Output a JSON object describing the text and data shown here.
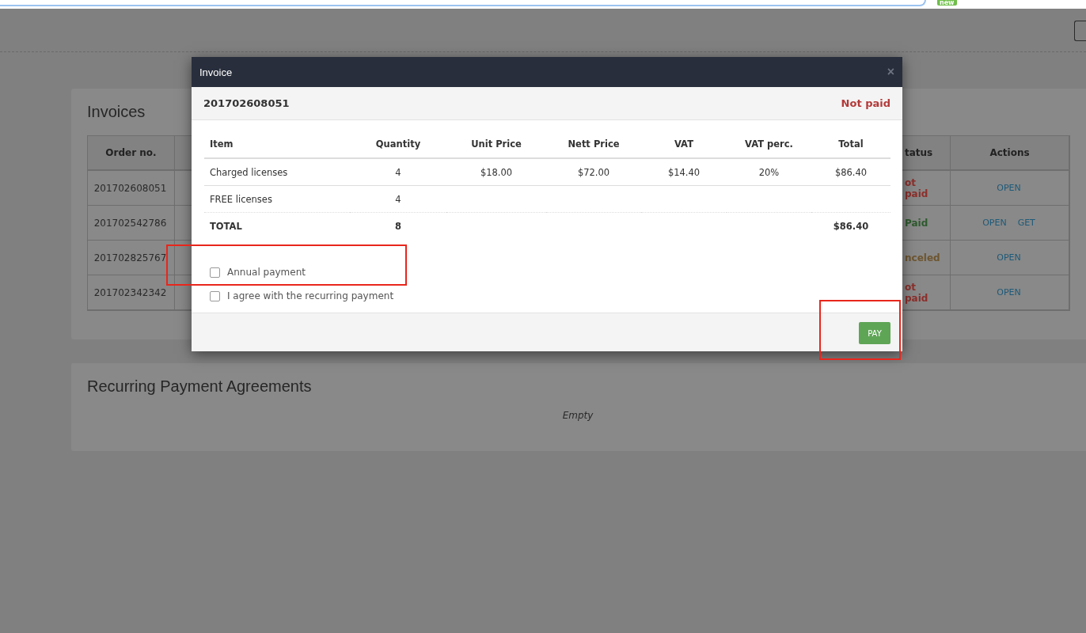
{
  "browser": {
    "badge": "new"
  },
  "invoices": {
    "title": "Invoices",
    "columns": {
      "order_no": "Order no.",
      "status": "tatus",
      "actions": "Actions"
    },
    "rows": [
      {
        "order_no": "201702608051",
        "status": {
          "text": "ot paid",
          "color": "#8c2f2b"
        },
        "actions": [
          "OPEN"
        ]
      },
      {
        "order_no": "201702542786",
        "status": {
          "text": "Paid",
          "color": "#2e5a2e"
        },
        "actions": [
          "OPEN",
          "GET"
        ]
      },
      {
        "order_no": "201702825767",
        "status": {
          "text": "nceled",
          "color": "#6e5530"
        },
        "actions": [
          "OPEN"
        ]
      },
      {
        "order_no": "201702342342",
        "status": {
          "text": "ot paid",
          "color": "#8c2f2b"
        },
        "actions": [
          "OPEN"
        ]
      }
    ]
  },
  "agreements": {
    "title": "Recurring Payment Agreements",
    "empty": "Empty"
  },
  "modal": {
    "title": "Invoice",
    "close": "×",
    "order_no": "201702608051",
    "status": "Not paid",
    "columns": [
      "Item",
      "Quantity",
      "Unit Price",
      "Nett Price",
      "VAT",
      "VAT perc.",
      "Total"
    ],
    "rows": [
      {
        "kind": "item",
        "cells": [
          "Charged licenses",
          "4",
          "$18.00",
          "$72.00",
          "$14.40",
          "20%",
          "$86.40"
        ]
      },
      {
        "kind": "item",
        "cells": [
          "FREE licenses",
          "4",
          null,
          null,
          null,
          null,
          null
        ]
      },
      {
        "kind": "total",
        "cells": [
          "TOTAL",
          "8",
          null,
          null,
          null,
          null,
          "$86.40"
        ]
      }
    ],
    "options": [
      {
        "label": "Annual payment",
        "checked": false
      },
      {
        "label": "I agree with the recurring payment",
        "checked": false
      }
    ],
    "button": "PAY"
  }
}
